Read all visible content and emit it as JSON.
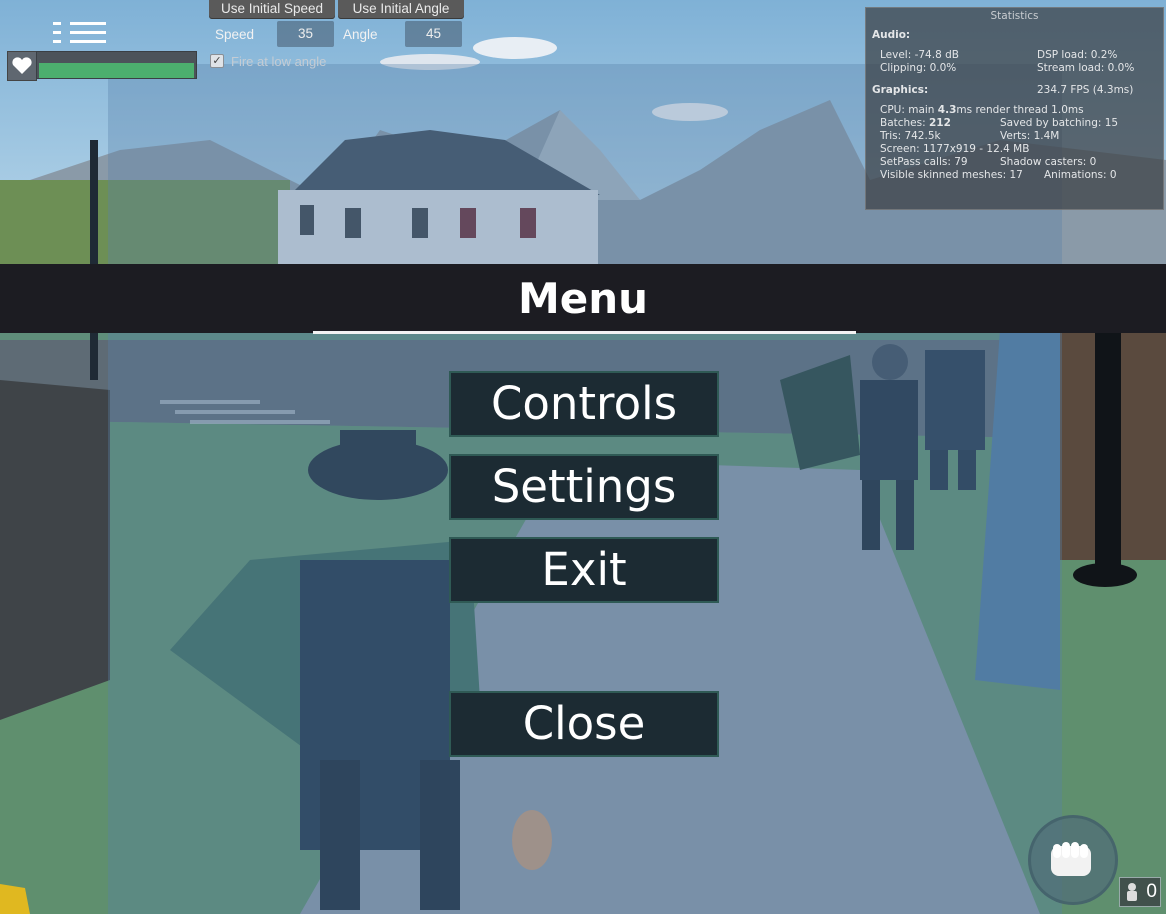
{
  "toolbar": {
    "initial_speed_button": "Use Initial Speed",
    "initial_angle_button": "Use Initial Angle",
    "speed_label": "Speed",
    "speed_value": "35",
    "angle_label": "Angle",
    "angle_value": "45",
    "fire_low_angle_label": "Fire at low angle",
    "fire_low_angle_checked": true
  },
  "player": {
    "health_fraction": 1.0,
    "health_color": "#4caf6e"
  },
  "statistics": {
    "title": "Statistics",
    "audio_heading": "Audio:",
    "level": "Level: -74.8 dB",
    "dsp_load": "DSP load: 0.2%",
    "clipping": "Clipping: 0.0%",
    "stream_load": "Stream load: 0.0%",
    "graphics_heading": "Graphics:",
    "fps": "234.7 FPS (4.3ms)",
    "cpu_prefix": "CPU: main ",
    "cpu_main": "4.3",
    "cpu_suffix": "ms  render thread 1.0ms",
    "batches_prefix": "Batches: ",
    "batches_value": "212",
    "saved_batching": "Saved by batching: 15",
    "tris": "Tris: 742.5k",
    "verts": "Verts: 1.4M",
    "screen": "Screen: 1177x919 - 12.4 MB",
    "setpass": "SetPass calls: 79",
    "shadow_casters": "Shadow casters: 0",
    "skinned_meshes": "Visible skinned meshes: 17",
    "animations": "Animations: 0"
  },
  "menu": {
    "title": "Menu",
    "controls": "Controls",
    "settings": "Settings",
    "exit": "Exit",
    "close": "Close"
  },
  "hud": {
    "item_count": "0"
  },
  "colors": {
    "menu_bar": "#1c1c22",
    "button_bg": "#1c2b33",
    "button_border": "#2f5a55"
  }
}
